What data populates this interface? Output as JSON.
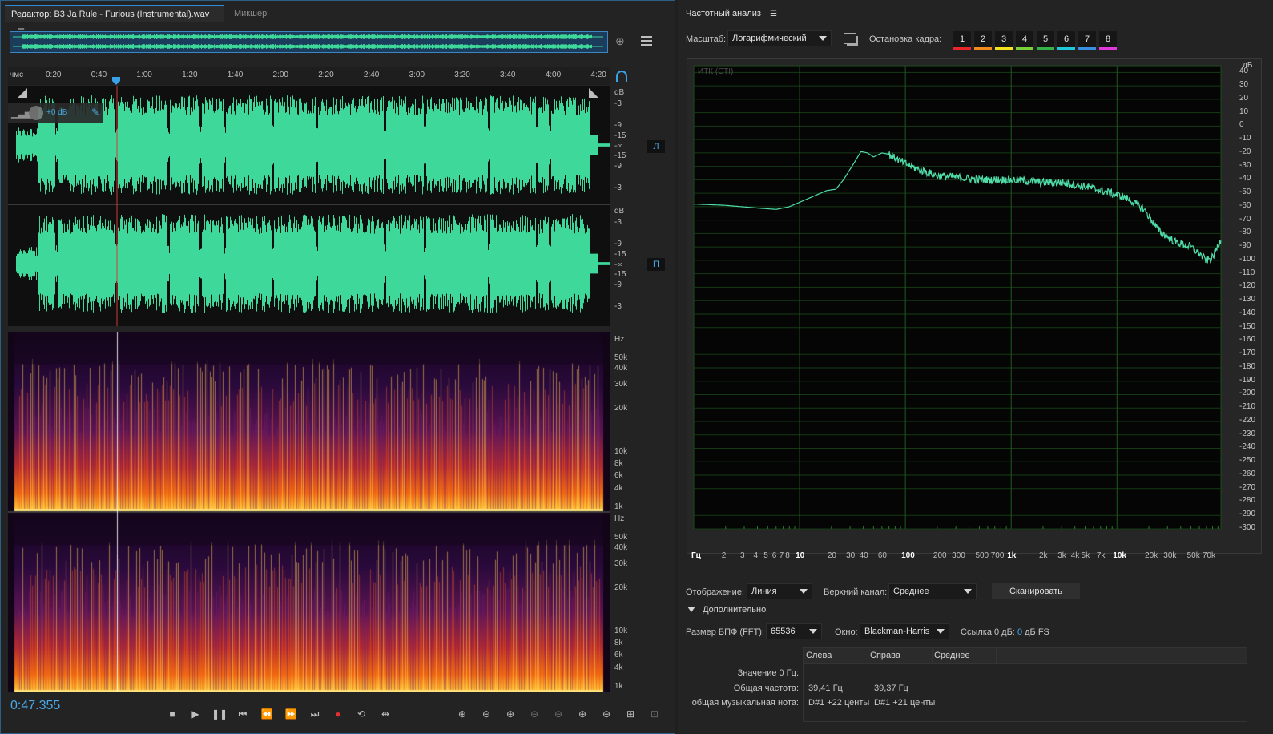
{
  "editor": {
    "tab_title": "Редактор: B3 Ja Rule - Furious (Instrumental).wav",
    "tab_mixer": "Микшер",
    "ruler": {
      "unit": "чмс",
      "ticks": [
        "0:20",
        "0:40",
        "1:00",
        "1:20",
        "1:40",
        "2:00",
        "2:20",
        "2:40",
        "3:00",
        "3:20",
        "3:40",
        "4:00",
        "4:20"
      ]
    },
    "gain_label": "+0 dB",
    "db_unit": "dB",
    "db_labels": [
      "-3",
      "-9",
      "-15",
      "-∞",
      "-15",
      "-9",
      "-3"
    ],
    "channel_left": "Л",
    "channel_right": "П",
    "hz_unit": "Hz",
    "hz_labels": [
      "50k",
      "40k",
      "30k",
      "20k",
      "10k",
      "8k",
      "6k",
      "4k",
      "1k"
    ],
    "time": "0:47.355",
    "waveform_color": "#3ed99a",
    "accent_color": "#2c8cd8"
  },
  "analysis": {
    "title": "Частотный анализ",
    "scale_label": "Масштаб:",
    "scale_value": "Логарифмический",
    "frame_stop_label": "Остановка кадра:",
    "frames": [
      {
        "n": "1",
        "color": "#e8262b"
      },
      {
        "n": "2",
        "color": "#f28a1e"
      },
      {
        "n": "3",
        "color": "#f5e21c"
      },
      {
        "n": "4",
        "color": "#7bd13a"
      },
      {
        "n": "5",
        "color": "#35b548"
      },
      {
        "n": "6",
        "color": "#1ec8d8"
      },
      {
        "n": "7",
        "color": "#3a8fe3"
      },
      {
        "n": "8",
        "color": "#e23ad8"
      }
    ],
    "graph_label": "ИТК (СТI)",
    "y_unit": "дБ",
    "y_labels": [
      "40",
      "30",
      "20",
      "10",
      "0",
      "-10",
      "-20",
      "-30",
      "-40",
      "-50",
      "-60",
      "-70",
      "-80",
      "-90",
      "-100",
      "-110",
      "-120",
      "-130",
      "-140",
      "-150",
      "-160",
      "-170",
      "-180",
      "-190",
      "-200",
      "-210",
      "-220",
      "-230",
      "-240",
      "-250",
      "-260",
      "-270",
      "-280",
      "-290",
      "-300"
    ],
    "x_labels": [
      {
        "t": "Гц",
        "b": true
      },
      {
        "t": "2",
        "b": false
      },
      {
        "t": "3",
        "b": false
      },
      {
        "t": "4",
        "b": false
      },
      {
        "t": "5",
        "b": false
      },
      {
        "t": "6",
        "b": false
      },
      {
        "t": "7",
        "b": false
      },
      {
        "t": "8",
        "b": false
      },
      {
        "t": "10",
        "b": true
      },
      {
        "t": "20",
        "b": false
      },
      {
        "t": "30",
        "b": false
      },
      {
        "t": "40",
        "b": false
      },
      {
        "t": "60",
        "b": false
      },
      {
        "t": "100",
        "b": true
      },
      {
        "t": "200",
        "b": false
      },
      {
        "t": "300",
        "b": false
      },
      {
        "t": "500",
        "b": false
      },
      {
        "t": "700",
        "b": false
      },
      {
        "t": "1k",
        "b": true
      },
      {
        "t": "2k",
        "b": false
      },
      {
        "t": "3k",
        "b": false
      },
      {
        "t": "4k",
        "b": false
      },
      {
        "t": "5k",
        "b": false
      },
      {
        "t": "7k",
        "b": false
      },
      {
        "t": "10k",
        "b": true
      },
      {
        "t": "20k",
        "b": false
      },
      {
        "t": "30k",
        "b": false
      },
      {
        "t": "50k",
        "b": false
      },
      {
        "t": "70k",
        "b": false
      }
    ],
    "spectrum_color": "#4fdca8",
    "display_label": "Отображение:",
    "display_value": "Линия",
    "top_channel_label": "Верхний канал:",
    "top_channel_value": "Среднее",
    "scan_button": "Сканировать",
    "advanced_label": "Дополнительно",
    "fft_label": "Размер БПФ (FFT):",
    "fft_value": "65536",
    "window_label": "Окно:",
    "window_value": "Blackman-Harris",
    "ref_label": "Ссылка 0 дБ:",
    "ref_value": "0",
    "ref_unit": "дБ FS",
    "table": {
      "headers": [
        "Слева",
        "Справа",
        "Среднее"
      ],
      "rows": [
        {
          "label": "Значение 0 Гц:",
          "left": "",
          "right": "",
          "avg": ""
        },
        {
          "label": "Общая частота:",
          "left": "39,41 Гц",
          "right": "39,37 Гц",
          "avg": ""
        },
        {
          "label": "общая музыкальная нота:",
          "left": "D#1 +22 центы",
          "right": "D#1 +21 центы",
          "avg": ""
        }
      ]
    }
  }
}
